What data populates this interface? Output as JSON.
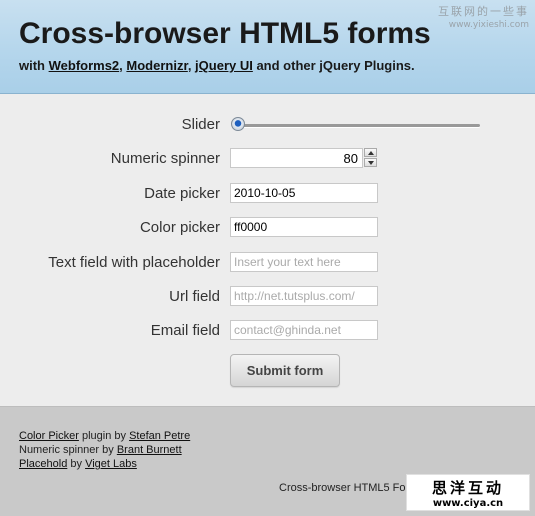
{
  "header": {
    "title": "Cross-browser HTML5 forms",
    "subtitle_prefix": "with ",
    "links": [
      "Webforms2",
      "Modernizr",
      "jQuery UI"
    ],
    "sep1": ", ",
    "sep2": ", ",
    "subtitle_suffix": " and other jQuery Plugins."
  },
  "watermark_top": {
    "text": "互联网的一些事",
    "url": "www.yixieshi.com"
  },
  "form": {
    "slider": {
      "label": "Slider",
      "value": 0
    },
    "spinner": {
      "label": "Numeric spinner",
      "value": "80"
    },
    "date": {
      "label": "Date picker",
      "value": "2010-10-05"
    },
    "color": {
      "label": "Color picker",
      "value": "ff0000"
    },
    "text": {
      "label": "Text field with placeholder",
      "placeholder": "Insert your text here"
    },
    "url": {
      "label": "Url field",
      "placeholder": "http://net.tutsplus.com/"
    },
    "email": {
      "label": "Email field",
      "placeholder": "contact@ghinda.net"
    },
    "submit_label": "Submit form"
  },
  "footer": {
    "credits": [
      {
        "link1": "Color Picker",
        "mid": " plugin by ",
        "link2": "Stefan Petre"
      },
      {
        "text": "Numeric spinner by ",
        "link2": "Brant Burnett"
      },
      {
        "link1": "Placehold",
        "mid": " by ",
        "link2": "Viget Labs"
      }
    ],
    "title": "Cross-browser HTML5 For"
  },
  "watermark_bottom": {
    "text": "思洋互动",
    "url": "www.ciya.cn"
  },
  "colors": {
    "header_bg": "#b5d6ec",
    "page_bg": "#ededed",
    "footer_bg": "#c9c9c9"
  }
}
